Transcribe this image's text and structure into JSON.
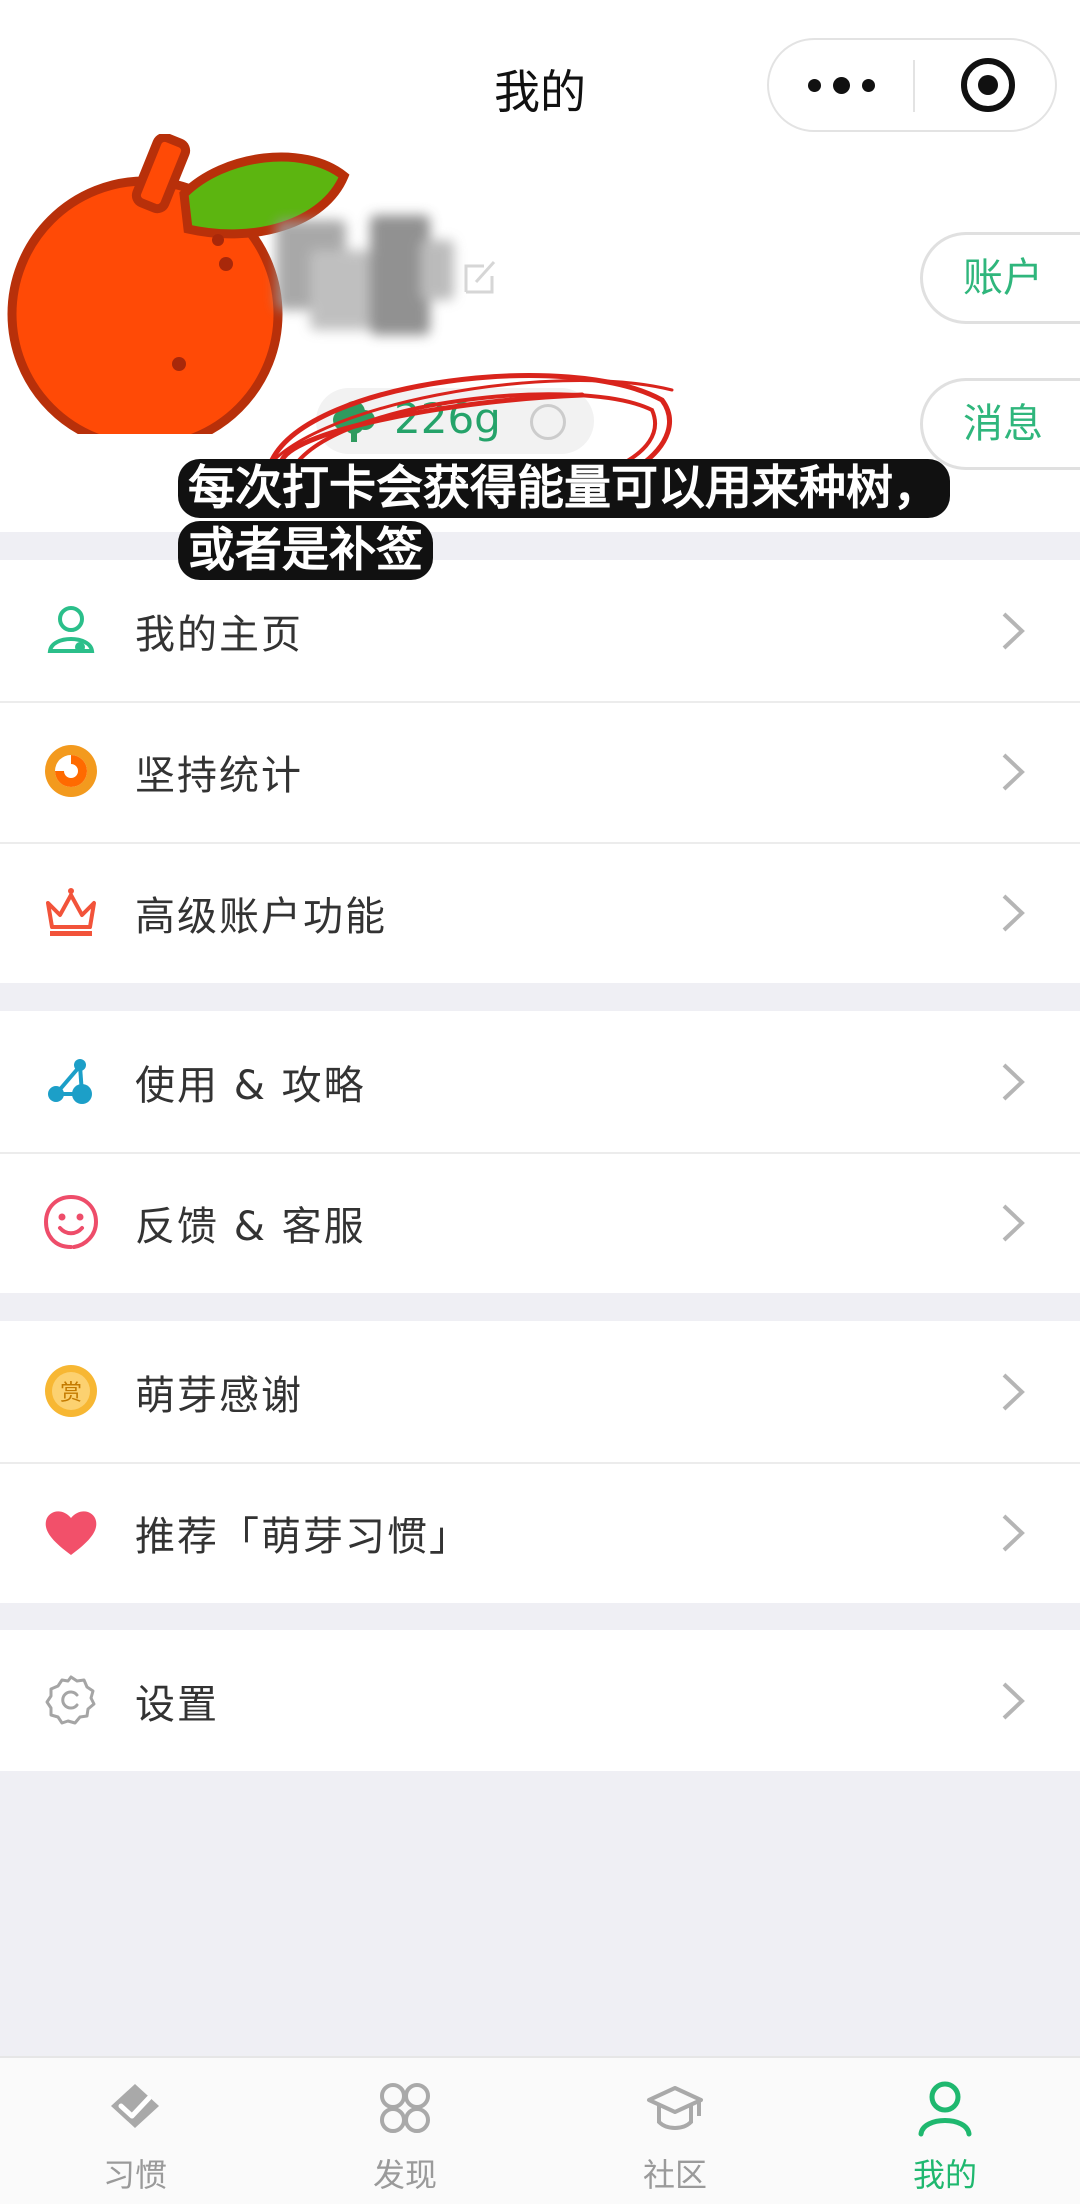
{
  "nav": {
    "title": "我的"
  },
  "profile": {
    "energy": "226g",
    "account_button": "账户",
    "message_button": "消息"
  },
  "caption": {
    "line1": "每次打卡会获得能量可以用来种树，",
    "line2": "或者是补签"
  },
  "menu_groups": [
    {
      "items": [
        {
          "label": "我的主页",
          "icon": "person-icon"
        },
        {
          "label": "坚持统计",
          "icon": "statistics-ring-icon"
        },
        {
          "label": "高级账户功能",
          "icon": "crown-icon"
        }
      ]
    },
    {
      "items": [
        {
          "label": "使用 & 攻略",
          "icon": "guide-nodes-icon"
        },
        {
          "label": "反馈 & 客服",
          "icon": "smiley-icon"
        }
      ]
    },
    {
      "items": [
        {
          "label": "萌芽感谢",
          "icon": "reward-coin-icon",
          "badge_text": "赏"
        },
        {
          "label": "推荐「萌芽习惯」",
          "icon": "heart-icon"
        }
      ]
    },
    {
      "items": [
        {
          "label": "设置",
          "icon": "gear-icon"
        }
      ]
    }
  ],
  "tabs": [
    {
      "label": "习惯",
      "icon": "habit-icon",
      "active": false
    },
    {
      "label": "发现",
      "icon": "discover-grid-icon",
      "active": false
    },
    {
      "label": "社区",
      "icon": "graduation-cap-icon",
      "active": false
    },
    {
      "label": "我的",
      "icon": "profile-icon",
      "active": true
    }
  ],
  "colors": {
    "accent_green": "#1fb86f",
    "energy_green": "#25a36a",
    "annotation_red": "#d9241c",
    "background": "#efeff4"
  }
}
